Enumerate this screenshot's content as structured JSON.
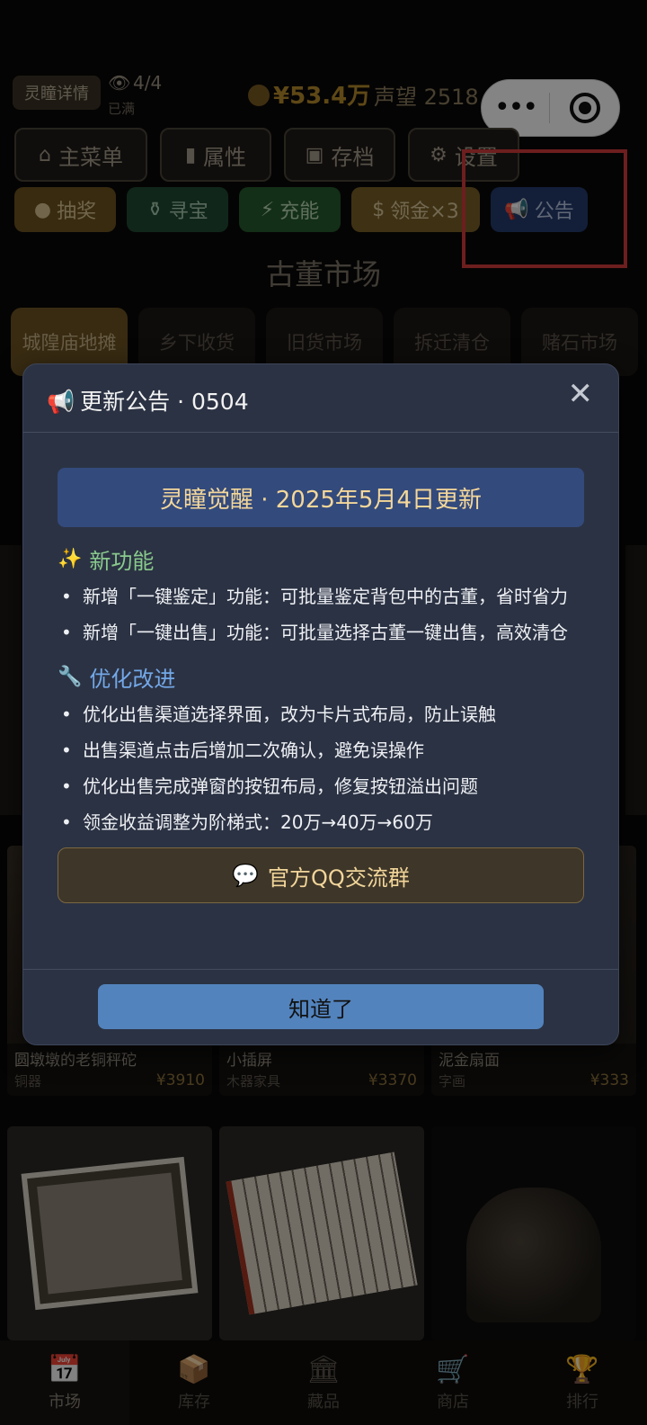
{
  "top_bar": {
    "detail_label": "灵瞳详情",
    "eye_icon": "eye-icon",
    "eye_count": "4/4",
    "full_status": "已满",
    "money": "¥53.4万",
    "money_icon": "money-bag-icon",
    "fame_text": "声望 2518"
  },
  "capsule": {
    "more_icon": "more-dots-icon",
    "close_icon": "target-circle-icon"
  },
  "menu": [
    {
      "label": "主菜单",
      "icon": "home-icon"
    },
    {
      "label": "属性",
      "icon": "bar-chart-icon"
    },
    {
      "label": "存档",
      "icon": "floppy-icon"
    },
    {
      "label": "设置",
      "icon": "gear-icon"
    }
  ],
  "actions": {
    "lottery": "抽奖",
    "treasure": "寻宝",
    "charge": "充能",
    "gold": "领金×3",
    "notice": "公告"
  },
  "market": {
    "title": "古董市场",
    "tabs": [
      "城隍庙地摊",
      "乡下收货",
      "旧货市场",
      "拆迁清仓",
      "赌石市场"
    ]
  },
  "items_row1": [
    {
      "name": "圆墩墩的老铜秤砣",
      "category": "铜器",
      "price": "¥3910"
    },
    {
      "name": "小插屏",
      "category": "木器家具",
      "price": "¥3370"
    },
    {
      "name": "泥金扇面",
      "category": "字画",
      "price": "¥333"
    }
  ],
  "modal": {
    "title": "更新公告 · 0504",
    "banner": "灵瞳觉醒 · 2025年5月4日更新",
    "new_features_title": "新功能",
    "new_features": [
      "新增「一键鉴定」功能：可批量鉴定背包中的古董，省时省力",
      "新增「一键出售」功能：可批量选择古董一键出售，高效清仓"
    ],
    "optimize_title": "优化改进",
    "optimizations": [
      "优化出售渠道选择界面，改为卡片式布局，防止误触",
      "出售渠道点击后增加二次确认，避免误操作",
      "优化出售完成弹窗的按钮布局，修复按钮溢出问题",
      "领金收益调整为阶梯式：20万→40万→60万"
    ],
    "qq_button": "官方QQ交流群",
    "ok_button": "知道了"
  },
  "bottom_nav": [
    {
      "label": "市场",
      "icon": "calendar-icon",
      "active": true
    },
    {
      "label": "库存",
      "icon": "box-icon",
      "active": false
    },
    {
      "label": "藏品",
      "icon": "museum-icon",
      "active": false
    },
    {
      "label": "商店",
      "icon": "cart-icon",
      "active": false
    },
    {
      "label": "排行",
      "icon": "trophy-icon",
      "active": false
    }
  ],
  "colors": {
    "modal_bg": "#2b3243",
    "banner_bg": "#334a7c",
    "banner_text": "#f4d79a",
    "ok_button": "#5283bd",
    "highlight_box": "#d13b3b"
  }
}
